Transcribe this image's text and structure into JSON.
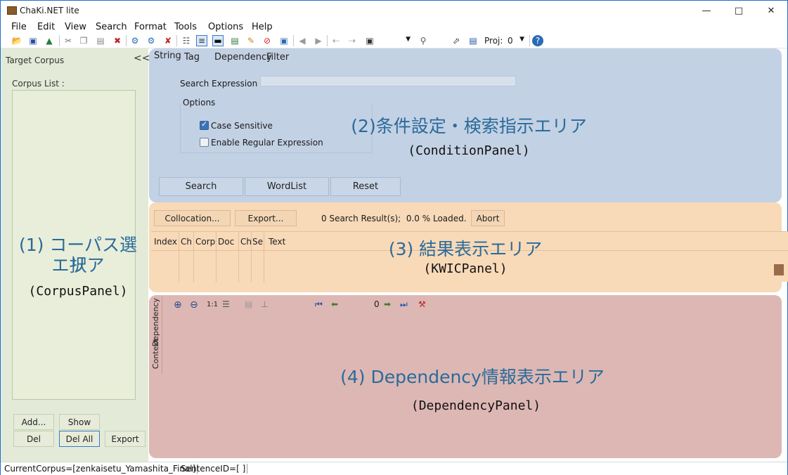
{
  "window": {
    "title": "ChaKi.NET lite"
  },
  "menu": [
    "File",
    "Edit",
    "View",
    "Search",
    "Format",
    "Tools",
    "Options",
    "Help"
  ],
  "toolbar": {
    "proj_label": "Proj:",
    "proj_value": "0"
  },
  "corpus_panel": {
    "header": "Target Corpus",
    "collapse": "<<",
    "list_label": "Corpus List :",
    "buttons": {
      "add": "Add...",
      "show": "Show",
      "del": "Del",
      "del_all": "Del All",
      "export": "Export"
    },
    "overlay_line1": "(1) コーパス選択",
    "overlay_line2": "エリア",
    "overlay_name": "(CorpusPanel)"
  },
  "condition_panel": {
    "tabs": [
      "String",
      "Tag",
      "Dependency",
      "Filter"
    ],
    "search_expression_label": "Search Expression",
    "options_label": "Options",
    "case_sensitive": "Case Sensitive",
    "case_sensitive_checked": true,
    "enable_regex": "Enable Regular Expression",
    "enable_regex_checked": false,
    "buttons": {
      "search": "Search",
      "wordlist": "WordList",
      "reset": "Reset"
    },
    "overlay_title": "(2)条件設定・検索指示エリア",
    "overlay_name": "(ConditionPanel)"
  },
  "kwic_panel": {
    "buttons": {
      "collocation": "Collocation...",
      "export": "Export...",
      "abort": "Abort"
    },
    "status": "0 Search Result(s);  0.0 % Loaded.",
    "columns": [
      "Index",
      "Ch",
      "Corp",
      "Doc",
      "Ch",
      "Se",
      "Text"
    ],
    "overlay_title": "(3) 結果表示エリア",
    "overlay_name": "(KWICPanel)"
  },
  "dependency_panel": {
    "side_tabs": [
      "Context",
      "Dependency"
    ],
    "zoom_label": "1:1",
    "sentence_counter": "0",
    "overlay_title": "(4) Dependency情報表示エリア",
    "overlay_name": "(DependencyPanel)"
  },
  "status_bar": {
    "current_corpus": "CurrentCorpus=[zenkaisetu_Yamashita_Final]",
    "sentence_id": "SentenceID=[ ]"
  },
  "colors": {
    "corpus_bg": "#e3ebd8",
    "condition_bg": "#c3d1e4",
    "kwic_bg": "#f8d9b8",
    "dependency_bg": "#ddb7b4",
    "overlay_text": "#2a6b9a"
  }
}
